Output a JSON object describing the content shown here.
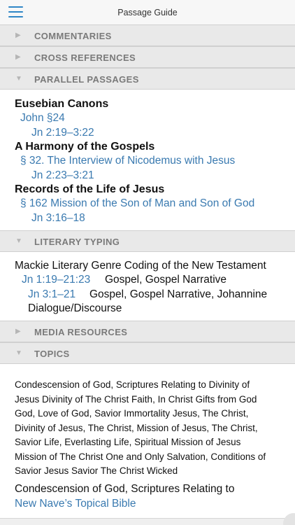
{
  "topbar": {
    "title": "Passage Guide"
  },
  "sections": {
    "commentaries": "COMMENTARIES",
    "cross_references": "CROSS REFERENCES",
    "parallel_passages": "PARALLEL PASSAGES",
    "literary_typing": "LITERARY TYPING",
    "media_resources": "MEDIA RESOURCES",
    "topics": "TOPICS"
  },
  "parallel": {
    "eusebian": {
      "title": "Eusebian Canons",
      "entry": "John §24",
      "ref": "Jn 2:19–3:22"
    },
    "harmony": {
      "title": "A Harmony of the Gospels",
      "entry": "§ 32. The Interview of Nicodemus with Jesus",
      "ref": "Jn 2:23–3:21"
    },
    "records": {
      "title": "Records of the Life of Jesus",
      "entry": "§ 162 Mission of the Son of Man and Son of God",
      "ref": "Jn 3:16–18"
    }
  },
  "literary": {
    "title": "Mackie Literary Genre Coding of the New Testament",
    "row1_ref": "Jn 1:19–21:23",
    "row1_text": "Gospel, Gospel Narrative",
    "row2_ref": "Jn 3:1–21",
    "row2_text_line1": "Gospel, Gospel Narrative, Johannine",
    "row2_text_line2": "Dialogue/Discourse"
  },
  "topics": {
    "lines": [
      "Condescension of God, Scriptures Relating to Divinity of",
      "Jesus Divinity of The Christ Faith, In Christ Gifts from God",
      "God, Love of God, Savior Immortality Jesus, The Christ,",
      "Divinity of Jesus, The Christ, Mission of Jesus, The Christ,",
      "Savior Life, Everlasting Life, Spiritual Mission of Jesus",
      "Mission of The Christ One and Only Salvation, Conditions of",
      "Savior Jesus Savior The Christ Wicked"
    ],
    "entry_title": "Condescension of God, Scriptures Relating to",
    "entry_source": "New Nave’s Topical Bible"
  },
  "icons": {
    "menu": "hamburger-menu-icon",
    "collapsed": "triangle-right-icon",
    "expanded": "triangle-down-icon"
  },
  "colors": {
    "link": "#3a7ab0",
    "accent": "#2f86c6",
    "header_bg": "#e9e9e9"
  }
}
